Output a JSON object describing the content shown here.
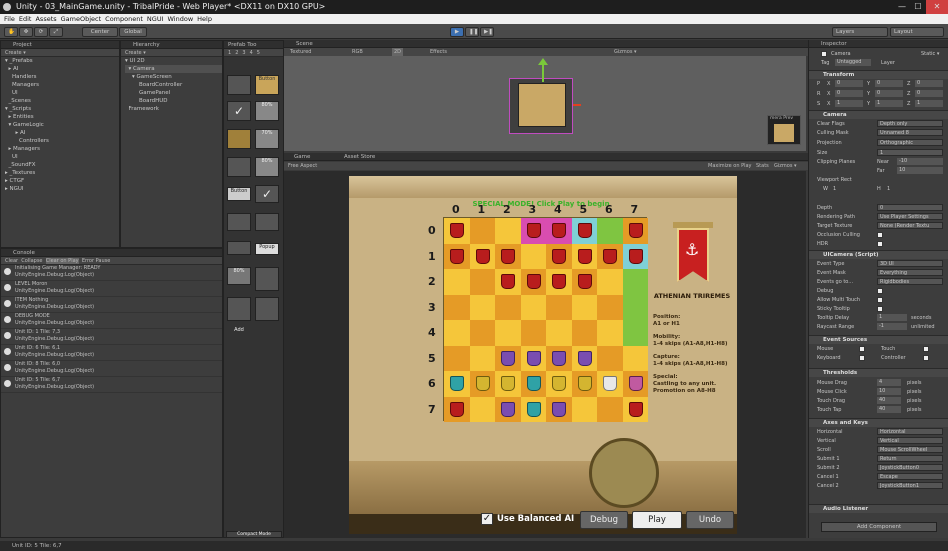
{
  "window": {
    "title": "Unity - 03_MainGame.unity - TribalPride - Web Player* <DX11 on DX10 GPU>"
  },
  "menu": [
    "File",
    "Edit",
    "Assets",
    "GameObject",
    "Component",
    "NGUI",
    "Window",
    "Help"
  ],
  "toolbar": {
    "pivot": "Center",
    "space": "Global",
    "layers": "Layers",
    "layout": "Layout"
  },
  "project": {
    "tab": "Project",
    "create": "Create ▾",
    "items": [
      "▾ _Prefabs",
      "  ▸ AI",
      "    Handlers",
      "    Managers",
      "    UI",
      "  _Scenes",
      "▾ _Scripts",
      "  ▸ Entities",
      "  ▾ GameLogic",
      "      ▸ AI",
      "        Controllers",
      "  ▸ Managers",
      "    UI",
      "  _SoundFX",
      "▸ _Textures",
      "▸ CTGF",
      "▸ NGUI"
    ]
  },
  "hierarchy": {
    "tab": "Hierarchy",
    "create": "Create ▾",
    "items": [
      "▾ UI 2D",
      "  ▾ Camera",
      "    ▾ GameScreen",
      "        BoardController",
      "        GamePanel",
      "        BoardHUD",
      "  Framework"
    ]
  },
  "prefab": {
    "tab": "Prefab Too",
    "pages": [
      "1",
      "2",
      "3",
      "4",
      "5"
    ],
    "button_label": "Button",
    "pct1": "80%",
    "pct2": "70%",
    "pct3": "80%",
    "button2": "Button",
    "popup": "Popup",
    "pct4": "80%",
    "add": "Add",
    "compact": "Compact Mode"
  },
  "scene": {
    "tab": "Scene",
    "textured": "Textured",
    "rgb": "RGB",
    "mode2d": "2D",
    "effects": "Effects",
    "gizmos": "Gizmos ▾",
    "camprev": "mera Prev"
  },
  "game_tabs": {
    "game": "Game",
    "asset": "Asset Store",
    "aspect": "Free Aspect",
    "maximize": "Maximize on Play",
    "stats": "Stats",
    "gizmos": "Gizmos ▾"
  },
  "console": {
    "tab": "Console",
    "clear": "Clear",
    "collapse": "Collapse",
    "clear_on_play": "Clear on Play",
    "error_pause": "Error Pause",
    "logs": [
      [
        "Initialising Game Manager: READY",
        "UnityEngine.Debug:Log(Object)"
      ],
      [
        "LEVEL Moron",
        "UnityEngine.Debug:Log(Object)"
      ],
      [
        "ITEM Nothing",
        "UnityEngine.Debug:Log(Object)"
      ],
      [
        "DEBUG MODE",
        "UnityEngine.Debug:Log(Object)"
      ],
      [
        "Unit ID: 1 Tile: 7,3",
        "UnityEngine.Debug:Log(Object)"
      ],
      [
        "Unit ID: 6 Tile: 6,1",
        "UnityEngine.Debug:Log(Object)"
      ],
      [
        "Unit ID: 8 Tile: 6,0",
        "UnityEngine.Debug:Log(Object)"
      ],
      [
        "Unit ID: 5 Tile: 6,7",
        "UnityEngine.Debug:Log(Object)"
      ]
    ]
  },
  "game": {
    "header": "SPECIAL MODE! Click Play to begin",
    "col_labels": [
      "0",
      "1",
      "2",
      "3",
      "4",
      "5",
      "6",
      "7"
    ],
    "row_labels": [
      "0",
      "1",
      "2",
      "3",
      "4",
      "5",
      "6",
      "7"
    ],
    "unit_name": "ATHENIAN TRIREMES",
    "position_label": "Position:",
    "position_value": "A1 or H1",
    "mobility_label": "Mobility:",
    "mobility_value": "1-4 skips (A1-A8,H1-H8)",
    "capture_label": "Capture:",
    "capture_value": "1-4 skips (A1-A8,H1-H8)",
    "special_label": "Special:",
    "special_value": "Castling to any unit. Promotion on A8-H8",
    "balanced_ai": "Use Balanced AI",
    "debug": "Debug",
    "play": "Play",
    "undo": "Undo"
  },
  "inspector": {
    "tab": "Inspector",
    "static": "Static ▾",
    "object": "Camera",
    "tag_label": "Tag",
    "tag": "Untagged",
    "layer_label": "Layer",
    "transform": "Transform",
    "p": "P",
    "r": "R",
    "s": "S",
    "x": "X",
    "y": "Y",
    "z": "Z",
    "p_vals": [
      "0",
      "0",
      "0"
    ],
    "r_vals": [
      "0",
      "0",
      "0"
    ],
    "s_vals": [
      "1",
      "1",
      "1"
    ],
    "camera": "Camera",
    "clear_flags": "Clear Flags",
    "clear_flags_v": "Depth only",
    "culling": "Culling Mask",
    "culling_v": "Unnamed 8",
    "projection": "Projection",
    "projection_v": "Orthographic",
    "size": "Size",
    "size_v": "1",
    "clipping": "Clipping Planes",
    "near": "Near",
    "near_v": "-10",
    "far": "Far",
    "far_v": "10",
    "viewport": "Viewport Rect",
    "w": "W",
    "h": "H",
    "vp_x": "0",
    "vp_y": "0",
    "vp_w": "1",
    "vp_h": "1",
    "depth": "Depth",
    "depth_v": "0",
    "rendering": "Rendering Path",
    "rendering_v": "Use Player Settings",
    "target": "Target Texture",
    "target_v": "None (Render Textu",
    "occlusion": "Occlusion Culling",
    "hdr": "HDR",
    "uicamera": "UICamera (Script)",
    "event_type": "Event Type",
    "event_type_v": "3D UI",
    "event_mask": "Event Mask",
    "event_mask_v": "Everything",
    "events_go": "Events go to...",
    "events_go_v": "Rigidbodies",
    "debug": "Debug",
    "multi": "Allow Multi Touch",
    "sticky": "Sticky Tooltip",
    "tt_delay": "Tooltip Delay",
    "tt_delay_v": "1",
    "seconds": "seconds",
    "raycast": "Raycast Range",
    "raycast_v": "-1",
    "unlimited": "unlimited",
    "event_sources": "Event Sources",
    "mouse": "Mouse",
    "touch": "Touch",
    "keyboard": "Keyboard",
    "controller": "Controller",
    "thresholds": "Thresholds",
    "mouse_drag": "Mouse Drag",
    "mouse_drag_v": "4",
    "mouse_click": "Mouse Click",
    "mouse_click_v": "10",
    "touch_drag": "Touch Drag",
    "touch_drag_v": "40",
    "touch_tap": "Touch Tap",
    "touch_tap_v": "40",
    "pixels": "pixels",
    "axes": "Axes and Keys",
    "horizontal": "Horizontal",
    "horizontal_v": "Horizontal",
    "vertical": "Vertical",
    "vertical_v": "Vertical",
    "scroll": "Scroll",
    "scroll_v": "Mouse ScrollWheel",
    "submit1": "Submit 1",
    "submit1_v": "Return",
    "submit2": "Submit 2",
    "submit2_v": "JoystickButton0",
    "cancel1": "Cancel 1",
    "cancel1_v": "Escape",
    "cancel2": "Cancel 2",
    "cancel2_v": "JoystickButton1",
    "audio": "Audio Listener",
    "add_component": "Add Component"
  },
  "status": "Unit ID: 5 Tile: 6,7"
}
